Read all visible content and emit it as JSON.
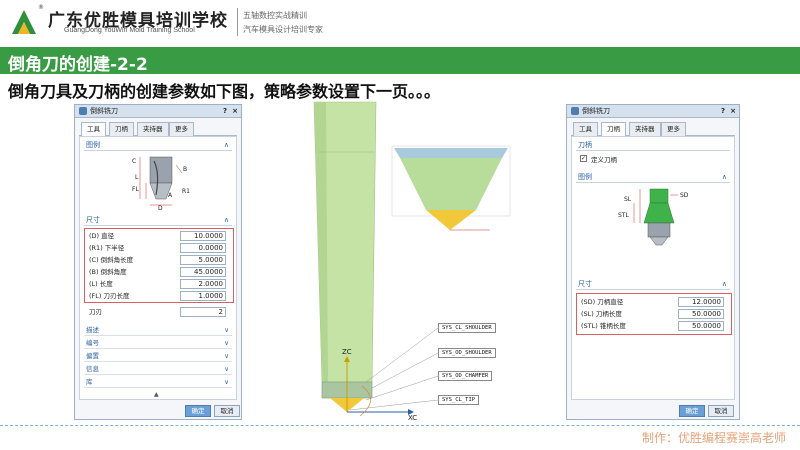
{
  "header": {
    "brand_cn": "广东优胜模具培训学校",
    "brand_en": "GuangDong YouWin Mold Training School",
    "registered_mark": "®",
    "slogan_line1": "五轴数控实战精训",
    "slogan_line2": "汽车模具设计培训专家"
  },
  "title": "倒角刀的创建-2-2",
  "subtitle": "倒角刀具及刀柄的创建参数如下图，策略参数设置下一页。。。",
  "left_dialog": {
    "window_title": "倒斜铣刀",
    "help": "?",
    "close": "×",
    "tabs": [
      "工具",
      "刀柄",
      "夹持器",
      "更多"
    ],
    "illustration_section": "图例",
    "illustration_labels": [
      "L",
      "C",
      "FL",
      "B",
      "A",
      "R1",
      "D"
    ],
    "dimensions_section": "尺寸",
    "params": [
      {
        "label": "(D) 直径",
        "value": "10.0000"
      },
      {
        "label": "(R1) 下半径",
        "value": "0.0000"
      },
      {
        "label": "(C) 倒斜角长度",
        "value": "5.0000"
      },
      {
        "label": "(B) 倒斜角度",
        "value": "45.0000"
      },
      {
        "label": "(L) 长度",
        "value": "2.0000"
      },
      {
        "label": "(FL) 刀刃长度",
        "value": "1.0000"
      }
    ],
    "flutes_label": "刀刃",
    "flutes_value": "2",
    "collapsed_sections": [
      "描述",
      "编号",
      "偏置",
      "信息",
      "库"
    ],
    "ok": "确定",
    "cancel": "取消"
  },
  "right_dialog": {
    "window_title": "倒斜铣刀",
    "help": "?",
    "close": "×",
    "tabs": [
      "工具",
      "刀柄",
      "夹持器",
      "更多"
    ],
    "holder_section": "刀柄",
    "define_holder": "定义刀柄",
    "illustration_section": "图例",
    "illustration_labels": [
      "SD",
      "SL",
      "STL"
    ],
    "dimensions_section": "尺寸",
    "params": [
      {
        "label": "(SD) 刀柄直径",
        "value": "12.0000"
      },
      {
        "label": "(SL) 刀柄长度",
        "value": "50.0000"
      },
      {
        "label": "(STL) 锥柄长度",
        "value": "50.0000"
      }
    ],
    "ok": "确定",
    "cancel": "取消"
  },
  "viewport": {
    "callouts": [
      "SYS_CL_SHOULDER",
      "SYS_OD_SHOULDER",
      "SYS_OD_CHAMFER",
      "SYS_CL_TIP"
    ],
    "axis_zc": "ZC",
    "axis_xc": "XC"
  },
  "footer": "制作：优胜编程赛崇高老师",
  "colors": {
    "title_bar": "#3a9b45",
    "tool_body": "#c5e3a4",
    "cone_top": "#a9c9dd",
    "footer_text": "#e3a37a"
  }
}
